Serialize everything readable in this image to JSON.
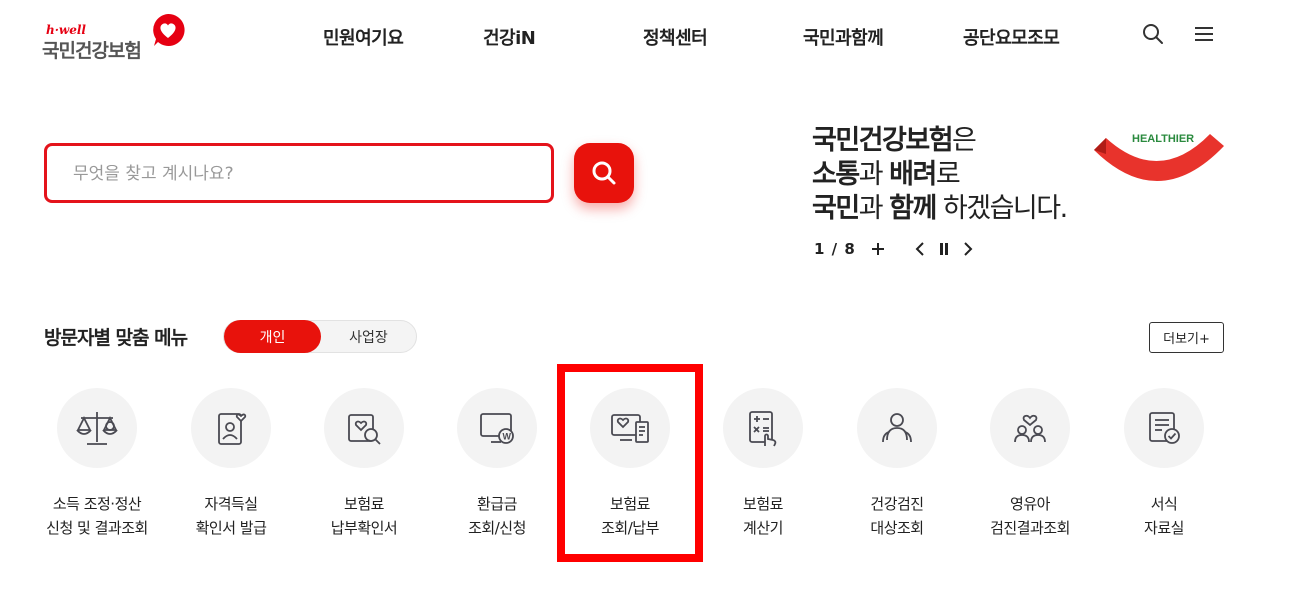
{
  "header": {
    "logo_small": "h·well",
    "logo_main": "국민건강보험",
    "nav": [
      "민원여기요",
      "건강iN",
      "정책센터",
      "국민과함께",
      "공단요모조모"
    ]
  },
  "search": {
    "placeholder": "무엇을 찾고 계시나요?"
  },
  "banner": {
    "line1_bold": "국민건강보험",
    "line1_rest": "은",
    "line2_bold1": "소통",
    "line2_mid": "과 ",
    "line2_bold2": "배려",
    "line2_rest": "로",
    "line3_bold1": "국민",
    "line3_mid": "과 ",
    "line3_bold2": "함께",
    "line3_rest": " 하겠습니다.",
    "graphic_text": "HEALTHIER",
    "slide_counter": "1 / 8"
  },
  "custom_menu": {
    "title": "방문자별 맞춤 메뉴",
    "tab_personal": "개인",
    "tab_business": "사업장",
    "more": "더보기+",
    "items": [
      {
        "line1": "소득 조정·정산",
        "line2": "신청 및 결과조회"
      },
      {
        "line1": "자격득실",
        "line2": "확인서 발급"
      },
      {
        "line1": "보험료",
        "line2": "납부확인서"
      },
      {
        "line1": "환급금",
        "line2": "조회/신청"
      },
      {
        "line1": "보험료",
        "line2": "조회/납부"
      },
      {
        "line1": "보험료",
        "line2": "계산기"
      },
      {
        "line1": "건강검진",
        "line2": "대상조회"
      },
      {
        "line1": "영유아",
        "line2": "검진결과조회"
      },
      {
        "line1": "서식",
        "line2": "자료실"
      }
    ]
  },
  "colors": {
    "brand_red": "#e8120c",
    "highlight_red": "#ff0000"
  },
  "icons": [
    "search-icon",
    "menu-icon",
    "plus-icon",
    "prev-icon",
    "pause-icon",
    "next-icon"
  ]
}
